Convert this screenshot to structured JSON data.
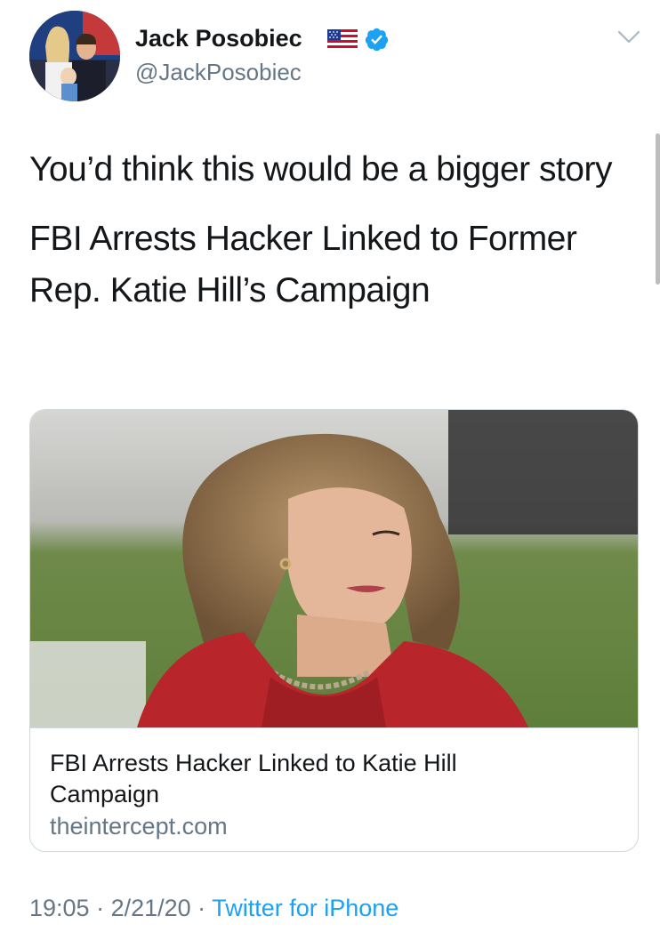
{
  "author": {
    "display_name": "Jack Posobiec",
    "handle": "@JackPosobiec",
    "flag_emoji_icon": "us-flag-icon",
    "verified_icon": "verified-badge-icon"
  },
  "tweet": {
    "text_line1": "You’d think this would be a bigger story",
    "text_line2": "FBI Arrests Hacker Linked to Former Rep. Katie Hill’s Campaign"
  },
  "card": {
    "title": "FBI Arrests Hacker Linked to Katie Hill Campaign",
    "domain": "theintercept.com"
  },
  "meta": {
    "time": "19:05",
    "separator1": " · ",
    "date": "2/21/20",
    "separator2": " · ",
    "source": "Twitter for iPhone"
  },
  "colors": {
    "link_blue": "#1da1f2",
    "secondary_gray": "#657786",
    "text": "#14171a",
    "border": "#cfd9de"
  }
}
